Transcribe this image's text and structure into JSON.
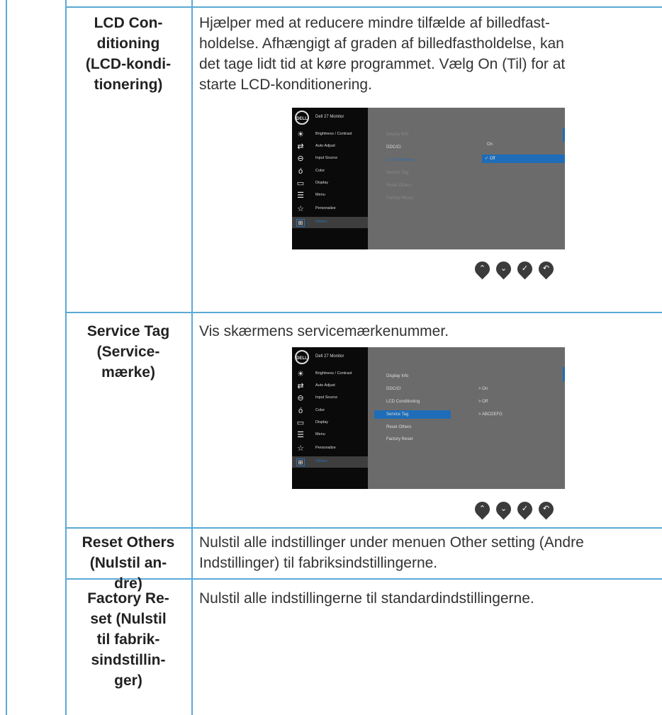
{
  "rows": [
    {
      "term": [
        "LCD Con-",
        "ditioning",
        "(LCD-kondi-",
        "tionering)"
      ],
      "desc": [
        "Hjælper med at reducere mindre tilfælde af billedfast-",
        "holdelse. Afhængigt af graden af billedfastholdelse, kan",
        "det tage lidt tid at køre programmet. Vælg On (Til) for at",
        "starte LCD-konditionering."
      ]
    },
    {
      "term": [
        "Service Tag",
        "(Service-",
        "mærke)"
      ],
      "desc": [
        "Vis skærmens servicemærkenummer."
      ]
    },
    {
      "term": [
        "Reset Others",
        "(Nulstil an-",
        "dre)"
      ],
      "desc": [
        "Nulstil alle indstillinger under menuen Other setting (Andre",
        "Indstillinger) til fabriksindstillingerne."
      ]
    },
    {
      "term": [
        "Factory Re-",
        "set (Nulstil",
        "til fabrik-",
        "sindstillin-",
        "ger)"
      ],
      "desc": [
        "Nulstil alle indstillingerne til standardindstillingerne."
      ]
    }
  ],
  "osd": {
    "logo": "DELL",
    "title": "Dell 27 Monitor",
    "menu": [
      "Brightness / Contrast",
      "Auto Adjust",
      "Input Source",
      "Color",
      "Display",
      "Menu",
      "Personalize",
      "Others"
    ],
    "menu_icons": [
      "brightness-icon",
      "auto-adjust-icon",
      "input-source-icon",
      "color-icon",
      "display-icon",
      "menu-icon",
      "personalize-icon",
      "others-icon"
    ],
    "submenu": [
      "Display Info",
      "DDC/CI",
      "LCD Conditioning",
      "Service Tag",
      "Reset Others",
      "Factory Reset"
    ],
    "lcd_options": [
      "On",
      "✓ Off"
    ],
    "service_values": [
      "> On",
      "> Off",
      "> ABCDEFG"
    ],
    "nav_icons": [
      "up-icon",
      "down-icon",
      "check-icon",
      "back-icon"
    ],
    "nav_glyphs": [
      "⌃",
      "⌄",
      "✓",
      "↶"
    ]
  },
  "colors": {
    "border": "#5aa9d6",
    "highlight": "#1f6db8"
  }
}
